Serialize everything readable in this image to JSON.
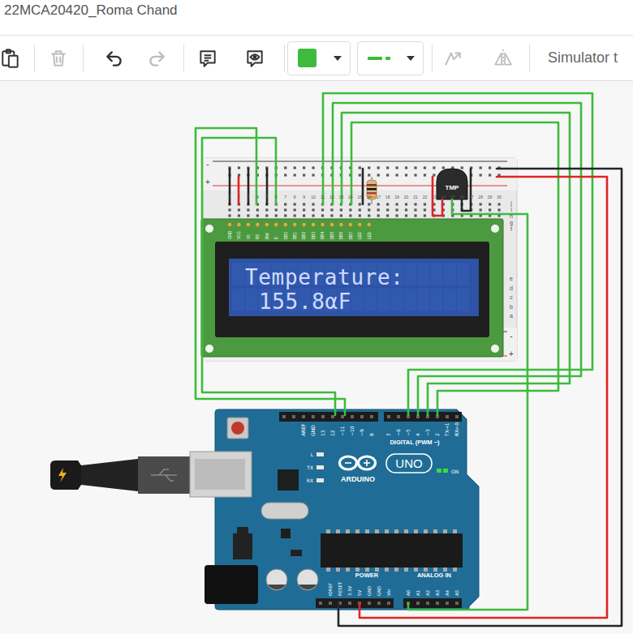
{
  "window": {
    "title": "22MCA20420_Roma Chand"
  },
  "toolbar": {
    "buttons": [
      {
        "disabled": false
      },
      {
        "disabled": true
      },
      {
        "disabled": false
      },
      {
        "disabled": true
      },
      {
        "disabled": false
      },
      {
        "disabled": false
      }
    ],
    "wire_color": "#3dbb3d",
    "tools": [
      {
        "disabled": true
      },
      {
        "disabled": true
      }
    ],
    "simulator_label": "Simulator t"
  },
  "breadboard": {
    "column_numbers": [
      "1",
      "2",
      "3",
      "4",
      "5",
      "6",
      "7",
      "8",
      "9",
      "10",
      "11",
      "12",
      "13",
      "14",
      "15",
      "16",
      "17",
      "18",
      "19",
      "20",
      "21",
      "22",
      "23",
      "24",
      "25",
      "26",
      "27",
      "28",
      "29",
      "30"
    ],
    "top_rows": [
      "j",
      "i",
      "h",
      "g",
      "f"
    ],
    "bottom_rows": [
      "e",
      "d",
      "c",
      "b",
      "a"
    ],
    "rail_signs_top": [
      "-",
      "+"
    ],
    "rail_signs_bottom": [
      "-",
      "+"
    ]
  },
  "lcd": {
    "pins": [
      "GND",
      "VCC",
      "V0",
      "RS",
      "RW",
      "E",
      "DB0",
      "DB1",
      "DB2",
      "DB3",
      "DB4",
      "DB5",
      "DB6",
      "DB7",
      "LED",
      "LED"
    ],
    "lines": [
      "Temperature:",
      "155.8αF"
    ]
  },
  "sensor": {
    "label": "TMP"
  },
  "wires": [
    {
      "color": "#3dbb3d"
    },
    {
      "color": "#3dbb3d"
    },
    {
      "color": "#3dbb3d"
    },
    {
      "color": "#3dbb3d"
    },
    {
      "color": "#3dbb3d"
    },
    {
      "color": "#3dbb3d"
    },
    {
      "color": "#e02424"
    },
    {
      "color": "#262626"
    },
    {
      "color": "#3dbb3d"
    },
    {
      "color": "#262626"
    },
    {
      "color": "#e02424"
    },
    {
      "color": "#262626"
    },
    {
      "color": "#262626"
    },
    {
      "color": "#262626"
    },
    {
      "color": "#e02424"
    },
    {
      "color": "#262626"
    }
  ],
  "arduino": {
    "header_left": [
      "AREF",
      "GND",
      "13",
      "12",
      "~11",
      "~10",
      "~9",
      "8"
    ],
    "header_right": [
      "7",
      "~6",
      "~5",
      "4",
      "~3",
      "2",
      "TX→1",
      "RX←0"
    ],
    "digital_label": "DIGITAL (PWM ~)",
    "leds": [
      {
        "label": "L"
      },
      {
        "label": "TX"
      },
      {
        "label": "RX"
      }
    ],
    "brand": "ARDUINO",
    "model": "UNO",
    "on_label": "ON",
    "power_label": "POWER",
    "power_pins": [
      "IOREF",
      "RESET",
      "3.3V",
      "5V",
      "GND",
      "GND",
      "Vin"
    ],
    "analog_label": "ANALOG IN",
    "analog_pins": [
      "A0",
      "A1",
      "A2",
      "A3",
      "A4",
      "A5"
    ]
  }
}
